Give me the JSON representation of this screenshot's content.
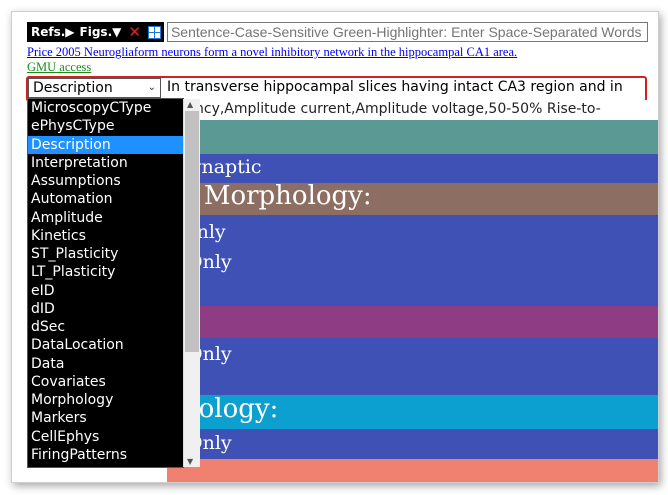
{
  "toolbar": {
    "refs_label": "Refs.▶",
    "figs_label": "Figs.▼",
    "close_glyph": "✕",
    "highlighter_placeholder": "Sentence-Case-Sensitive Green-Highlighter: Enter Space-Separated Words"
  },
  "citation_link": "Price 2005 Neurogliaform neurons form a novel inhibitory network in the hippocampal CA1 area.",
  "gmu_link": "GMU access",
  "field_selector": {
    "selected": "Description",
    "text": "In transverse hippocampal slices having intact CA3 region and in"
  },
  "dropdown": {
    "options": [
      "MicroscopyCType",
      "ePhysCType",
      "Description",
      "Interpretation",
      "Assumptions",
      "Automation",
      "Amplitude",
      "Kinetics",
      "ST_Plasticity",
      "LT_Plasticity",
      "eID",
      "dID",
      "dSec",
      "DataLocation",
      "Data",
      "Covariates",
      "Morphology",
      "Markers",
      "CellEphys",
      "FiringPatterns"
    ],
    "selected_index": 2
  },
  "content": {
    "props_line": "ncy,Amplitude current,Amplitude voltage,50-50% Rise-to-",
    "strip_blue1_text": "synaptic",
    "strip_brown_text": "c Morphology:",
    "strip_blue2_line1": "Only",
    "strip_blue2_line2": "Only",
    "strip_blue3_text": "Only",
    "strip_cyan_text": "siology:",
    "strip_blue4_text": "Only"
  },
  "colors": {
    "teal": "#5b9994",
    "blue": "#3f51b5",
    "brown": "#8d6e63",
    "purple": "#8e3c84",
    "cyan": "#0ca0d0",
    "salmon": "#f08070",
    "selection_blue": "#1e90ff",
    "selector_border_red": "#d61f1f"
  }
}
